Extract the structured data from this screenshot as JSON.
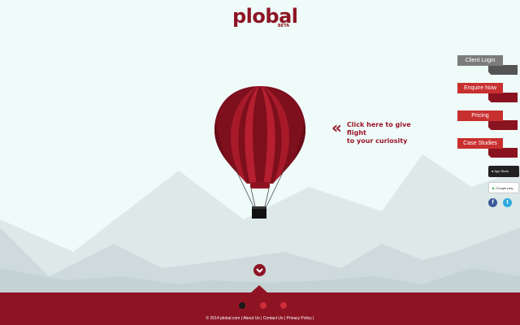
{
  "brand": {
    "name": "plobal",
    "tag": "BETA",
    "color": "#8e1424"
  },
  "hero": {
    "cta_icon": "double-chevron-left-icon",
    "cta_line1": "Click here to give flight",
    "cta_line2": "to your curiosity"
  },
  "sidebar": {
    "buttons": [
      {
        "label": "Client Login",
        "color": "#7c7c7c"
      },
      {
        "label": "Enquire Now",
        "color": "#c8302f"
      },
      {
        "label": "Pricing",
        "color": "#c8302f"
      },
      {
        "label": "Case Studies",
        "color": "#c8302f"
      }
    ],
    "stores": [
      {
        "label": "App Store",
        "icon": "apple-icon"
      },
      {
        "label": "Google play",
        "icon": "google-play-icon"
      }
    ],
    "social": [
      {
        "icon": "facebook-icon",
        "glyph": "f",
        "color": "#3b5998"
      },
      {
        "icon": "twitter-icon",
        "glyph": "t",
        "color": "#2fa8e0"
      }
    ]
  },
  "footer": {
    "copyright": "© 2014 plobal.com |",
    "links": [
      "About Us",
      "Contact Us",
      "Privacy Policy"
    ],
    "separator": "|",
    "slide_dots": [
      "active",
      "inactive",
      "inactive"
    ]
  }
}
